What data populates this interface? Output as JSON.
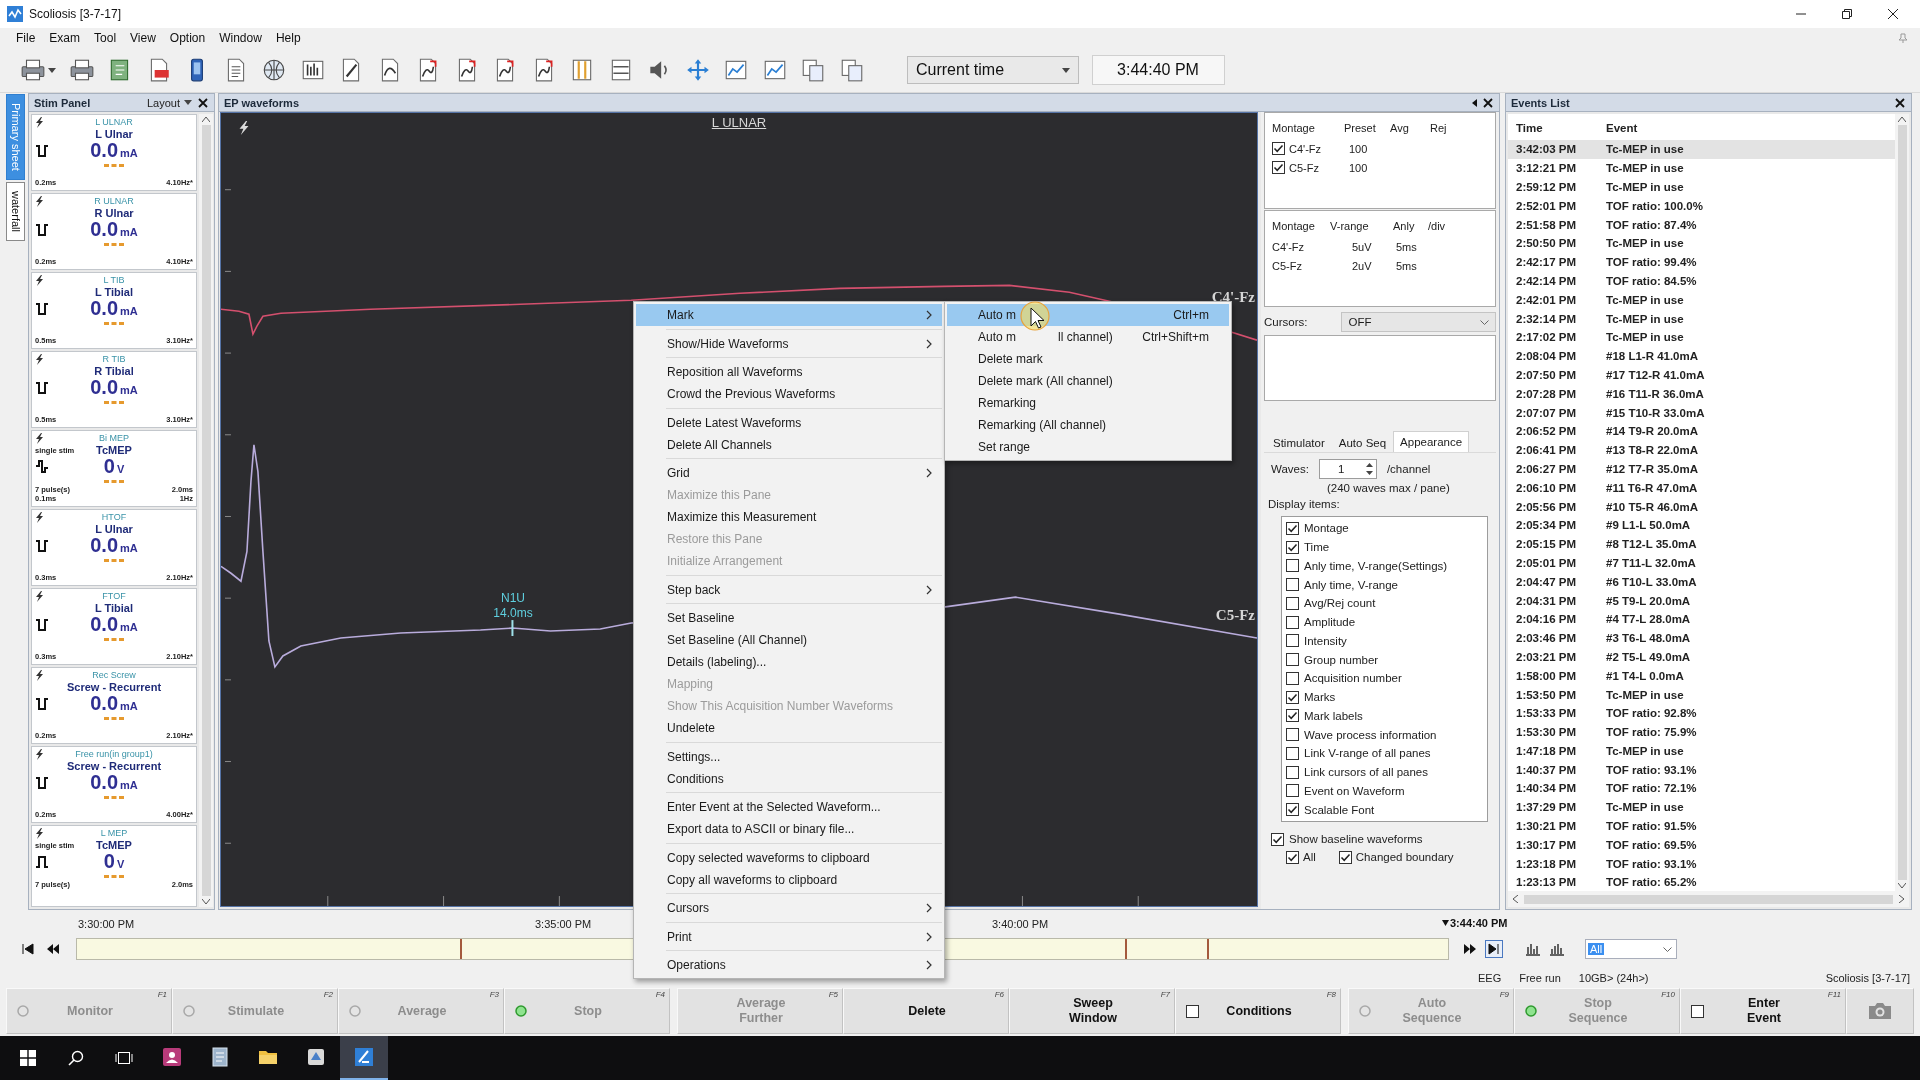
{
  "window": {
    "title": "Scoliosis [3-7-17]"
  },
  "menu_bar": [
    "File",
    "Exam",
    "Tool",
    "View",
    "Option",
    "Window",
    "Help"
  ],
  "toolbar": {
    "time_mode": "Current time",
    "time": "3:44:40 PM"
  },
  "stim_panel": {
    "title": "Stim Panel",
    "layout": "Layout",
    "sheet_tabs": [
      {
        "label": "Primary sheet",
        "selected": true
      },
      {
        "label": "waterfall",
        "selected": false
      }
    ],
    "cards": [
      {
        "kind": "biphasic",
        "title": "L ULNAR",
        "name": "L Ulnar",
        "value": "0.0",
        "unit": "mA",
        "width": "0.2ms",
        "rate": "4.10Hz*"
      },
      {
        "kind": "biphasic",
        "title": "R ULNAR",
        "name": "R Ulnar",
        "value": "0.0",
        "unit": "mA",
        "width": "0.2ms",
        "rate": "4.10Hz*"
      },
      {
        "kind": "biphasic",
        "title": "L TIB",
        "name": "L Tibial",
        "value": "0.0",
        "unit": "mA",
        "width": "0.5ms",
        "rate": "3.10Hz*"
      },
      {
        "kind": "biphasic",
        "title": "R TIB",
        "name": "R Tibial",
        "value": "0.0",
        "unit": "mA",
        "width": "0.5ms",
        "rate": "3.10Hz*"
      },
      {
        "kind": "step",
        "mode": "single stim",
        "title": "Bi MEP",
        "name": "TcMEP",
        "value": "0",
        "unit": "V",
        "pulses": "7 pulse(s)",
        "width": "0.1ms",
        "interval": "2.0ms",
        "rate": "1Hz"
      },
      {
        "kind": "biphasic",
        "title": "HTOF",
        "name": "L Ulnar",
        "value": "0.0",
        "unit": "mA",
        "width": "0.3ms",
        "rate": "2.10Hz*"
      },
      {
        "kind": "biphasic",
        "title": "FTOF",
        "name": "L Tibial",
        "value": "0.0",
        "unit": "mA",
        "width": "0.3ms",
        "rate": "2.10Hz*"
      },
      {
        "kind": "biphasic",
        "title": "Rec Screw",
        "name": "Screw - Recurrent",
        "value": "0.0",
        "unit": "mA",
        "width": "0.2ms",
        "rate": "2.10Hz*"
      },
      {
        "kind": "biphasic",
        "title": "Free run(in group1)",
        "name": "Screw - Recurrent",
        "value": "0.0",
        "unit": "mA",
        "width": "0.2ms",
        "rate": "4.00Hz*"
      },
      {
        "kind": "mono",
        "mode": "single stim",
        "title": "L MEP",
        "name": "TcMEP",
        "value": "0",
        "unit": "V",
        "pulses": "7 pulse(s)",
        "interval": "2.0ms"
      }
    ]
  },
  "ep_pane": {
    "title": "EP waveforms",
    "plot_title": "L ULNAR",
    "traces": [
      {
        "label": "C4'-Fz",
        "color": "#d4506e"
      },
      {
        "label": "C5-Fz",
        "color": "#b9acdc"
      }
    ],
    "mark": {
      "name": "N1U",
      "latency": "14.0ms"
    }
  },
  "montage_table": {
    "columns": [
      "Montage",
      "Preset",
      "Avg",
      "Rej"
    ],
    "rows": [
      {
        "montage": "C4'-Fz",
        "checked": true,
        "preset": "100"
      },
      {
        "montage": "C5-Fz",
        "checked": true,
        "preset": "100"
      }
    ]
  },
  "range_table": {
    "columns": [
      "Montage",
      "V-range",
      "Anly",
      "/div"
    ],
    "rows": [
      {
        "montage": "C4'-Fz",
        "v_range": "5uV",
        "anly": "5ms"
      },
      {
        "montage": "C5-Fz",
        "v_range": "2uV",
        "anly": "5ms"
      }
    ]
  },
  "cursors": {
    "label": "Cursors:",
    "value": "OFF"
  },
  "settings_tabs": [
    {
      "label": "Stimulator",
      "selected": false
    },
    {
      "label": "Auto Seq",
      "selected": false
    },
    {
      "label": "Appearance",
      "selected": true
    }
  ],
  "waves": {
    "label": "Waves:",
    "value": "1",
    "unit": "/channel",
    "note": "(240 waves max / pane)"
  },
  "display_items": {
    "label": "Display items:",
    "items": [
      {
        "label": "Montage",
        "checked": true
      },
      {
        "label": "Time",
        "checked": true
      },
      {
        "label": "Anly time, V-range(Settings)",
        "checked": false
      },
      {
        "label": "Anly time, V-range",
        "checked": false
      },
      {
        "label": "Avg/Rej count",
        "checked": false
      },
      {
        "label": "Amplitude",
        "checked": false
      },
      {
        "label": "Intensity",
        "checked": false
      },
      {
        "label": "Group number",
        "checked": false
      },
      {
        "label": "Acquisition number",
        "checked": false
      },
      {
        "label": "Marks",
        "checked": true
      },
      {
        "label": "Mark labels",
        "checked": true
      },
      {
        "label": "Wave process information",
        "checked": false
      },
      {
        "label": "Link V-range of all panes",
        "checked": false
      },
      {
        "label": "Link cursors of all panes",
        "checked": false
      },
      {
        "label": "Event on Waveform",
        "checked": false
      },
      {
        "label": "Scalable Font",
        "checked": true
      }
    ]
  },
  "baseline": {
    "label": "Show baseline waveforms",
    "checked": true,
    "options": [
      {
        "label": "All",
        "checked": true
      },
      {
        "label": "Changed boundary",
        "checked": true
      }
    ]
  },
  "events_list": {
    "title": "Events List",
    "columns": [
      "Time",
      "Event"
    ],
    "rows": [
      {
        "time": "3:42:03 PM",
        "event": "Tc-MEP in use",
        "selected": true
      },
      {
        "time": "3:12:21 PM",
        "event": "Tc-MEP in use",
        "selected": false
      },
      {
        "time": "2:59:12 PM",
        "event": "Tc-MEP in use",
        "selected": false
      },
      {
        "time": "2:52:01 PM",
        "event": "TOF ratio: 100.0%",
        "selected": false
      },
      {
        "time": "2:51:58 PM",
        "event": "TOF ratio: 87.4%",
        "selected": false
      },
      {
        "time": "2:50:50 PM",
        "event": "Tc-MEP in use",
        "selected": false
      },
      {
        "time": "2:42:17 PM",
        "event": "TOF ratio: 99.4%",
        "selected": false
      },
      {
        "time": "2:42:14 PM",
        "event": "TOF ratio: 84.5%",
        "selected": false
      },
      {
        "time": "2:42:01 PM",
        "event": "Tc-MEP in use",
        "selected": false
      },
      {
        "time": "2:32:14 PM",
        "event": "Tc-MEP in use",
        "selected": false
      },
      {
        "time": "2:17:02 PM",
        "event": "Tc-MEP in use",
        "selected": false
      },
      {
        "time": "2:08:04 PM",
        "event": "#18 L1-R 41.0mA",
        "selected": false
      },
      {
        "time": "2:07:50 PM",
        "event": "#17 T12-R 41.0mA",
        "selected": false
      },
      {
        "time": "2:07:28 PM",
        "event": "#16 T11-R 36.0mA",
        "selected": false
      },
      {
        "time": "2:07:07 PM",
        "event": "#15 T10-R 33.0mA",
        "selected": false
      },
      {
        "time": "2:06:52 PM",
        "event": "#14 T9-R 20.0mA",
        "selected": false
      },
      {
        "time": "2:06:41 PM",
        "event": "#13 T8-R 22.0mA",
        "selected": false
      },
      {
        "time": "2:06:27 PM",
        "event": "#12 T7-R 35.0mA",
        "selected": false
      },
      {
        "time": "2:06:10 PM",
        "event": "#11 T6-R 47.0mA",
        "selected": false
      },
      {
        "time": "2:05:56 PM",
        "event": "#10 T5-R 46.0mA",
        "selected": false
      },
      {
        "time": "2:05:34 PM",
        "event": "#9 L1-L 50.0mA",
        "selected": false
      },
      {
        "time": "2:05:15 PM",
        "event": "#8 T12-L 35.0mA",
        "selected": false
      },
      {
        "time": "2:05:01 PM",
        "event": "#7 T11-L 32.0mA",
        "selected": false
      },
      {
        "time": "2:04:47 PM",
        "event": "#6 T10-L 33.0mA",
        "selected": false
      },
      {
        "time": "2:04:31 PM",
        "event": "#5 T9-L 20.0mA",
        "selected": false
      },
      {
        "time": "2:04:16 PM",
        "event": "#4 T7-L 28.0mA",
        "selected": false
      },
      {
        "time": "2:03:46 PM",
        "event": "#3 T6-L 48.0mA",
        "selected": false
      },
      {
        "time": "2:03:21 PM",
        "event": "#2 T5-L 49.0mA",
        "selected": false
      },
      {
        "time": "1:58:00 PM",
        "event": "#1 T4-L 0.0mA",
        "selected": false
      },
      {
        "time": "1:53:50 PM",
        "event": "Tc-MEP in use",
        "selected": false
      },
      {
        "time": "1:53:33 PM",
        "event": "TOF ratio: 92.8%",
        "selected": false
      },
      {
        "time": "1:53:30 PM",
        "event": "TOF ratio: 75.9%",
        "selected": false
      },
      {
        "time": "1:47:18 PM",
        "event": "Tc-MEP in use",
        "selected": false
      },
      {
        "time": "1:40:37 PM",
        "event": "TOF ratio: 93.1%",
        "selected": false
      },
      {
        "time": "1:40:34 PM",
        "event": "TOF ratio: 72.1%",
        "selected": false
      },
      {
        "time": "1:37:29 PM",
        "event": "Tc-MEP in use",
        "selected": false
      },
      {
        "time": "1:30:21 PM",
        "event": "TOF ratio: 91.5%",
        "selected": false
      },
      {
        "time": "1:30:17 PM",
        "event": "TOF ratio: 69.5%",
        "selected": false
      },
      {
        "time": "1:23:18 PM",
        "event": "TOF ratio: 93.1%",
        "selected": false
      },
      {
        "time": "1:23:13 PM",
        "event": "TOF ratio: 65.2%",
        "selected": false
      }
    ]
  },
  "timeline": {
    "ticks": [
      "3:30:00 PM",
      "3:35:00 PM",
      "3:40:00 PM"
    ],
    "current": "3:44:40 PM",
    "filter": "All"
  },
  "status_bar": [
    "EEG",
    "Free run",
    "10GB> (24h>)",
    "Scoliosis [3-7-17]"
  ],
  "function_keys": [
    {
      "label": "Monitor",
      "key": "F1",
      "disabled": true,
      "kind": "lamp",
      "lit": false
    },
    {
      "label": "Stimulate",
      "key": "F2",
      "disabled": true,
      "kind": "lamp",
      "lit": false
    },
    {
      "label": "Average",
      "key": "F3",
      "disabled": true,
      "kind": "lamp",
      "lit": false
    },
    {
      "label": "Stop",
      "key": "F4",
      "disabled": true,
      "kind": "lamp",
      "lit": true
    },
    {
      "label": "Average\nFurther",
      "key": "F5",
      "disabled": true,
      "kind": "plain"
    },
    {
      "label": "Delete",
      "key": "F6",
      "disabled": false,
      "kind": "plain"
    },
    {
      "label": "Sweep\nWindow",
      "key": "F7",
      "disabled": false,
      "kind": "plain"
    },
    {
      "label": "Conditions",
      "key": "F8",
      "disabled": false,
      "kind": "check",
      "checked": false
    },
    {
      "label": "Auto\nSequence",
      "key": "F9",
      "disabled": true,
      "kind": "lamp",
      "lit": false
    },
    {
      "label": "Stop\nSequence",
      "key": "F10",
      "disabled": true,
      "kind": "lamp",
      "lit": true
    },
    {
      "label": "Enter\nEvent",
      "key": "F11",
      "disabled": false,
      "kind": "check",
      "checked": false
    }
  ],
  "context_menu": {
    "groups": [
      [
        {
          "label": "Mark",
          "submenu": true,
          "disabled": false,
          "selected": true
        }
      ],
      [
        {
          "label": "Show/Hide Waveforms",
          "submenu": true,
          "disabled": false,
          "selected": false
        }
      ],
      [
        {
          "label": "Reposition all Waveforms",
          "submenu": false,
          "disabled": false,
          "selected": false
        },
        {
          "label": "Crowd the Previous Waveforms",
          "submenu": false,
          "disabled": false,
          "selected": false
        }
      ],
      [
        {
          "label": "Delete Latest Waveforms",
          "submenu": false,
          "disabled": false,
          "selected": false
        },
        {
          "label": "Delete All Channels",
          "submenu": false,
          "disabled": false,
          "selected": false
        }
      ],
      [
        {
          "label": "Grid",
          "submenu": true,
          "disabled": false,
          "selected": false
        },
        {
          "label": "Maximize this Pane",
          "submenu": false,
          "disabled": true,
          "selected": false
        },
        {
          "label": "Maximize this Measurement",
          "submenu": false,
          "disabled": false,
          "selected": false
        },
        {
          "label": "Restore this Pane",
          "submenu": false,
          "disabled": true,
          "selected": false
        },
        {
          "label": "Initialize Arrangement",
          "submenu": false,
          "disabled": true,
          "selected": false
        }
      ],
      [
        {
          "label": "Step back",
          "submenu": true,
          "disabled": false,
          "selected": false
        }
      ],
      [
        {
          "label": "Set Baseline",
          "submenu": false,
          "disabled": false,
          "selected": false
        },
        {
          "label": "Set Baseline (All Channel)",
          "submenu": false,
          "disabled": false,
          "selected": false
        },
        {
          "label": "Details (labeling)...",
          "submenu": false,
          "disabled": false,
          "selected": false
        },
        {
          "label": "Mapping",
          "submenu": false,
          "disabled": true,
          "selected": false
        },
        {
          "label": "Show This Acquisition Number Waveforms",
          "submenu": false,
          "disabled": true,
          "selected": false
        },
        {
          "label": "Undelete",
          "submenu": false,
          "disabled": false,
          "selected": false
        }
      ],
      [
        {
          "label": "Settings...",
          "submenu": false,
          "disabled": false,
          "selected": false
        },
        {
          "label": "Conditions",
          "submenu": false,
          "disabled": false,
          "selected": false
        }
      ],
      [
        {
          "label": "Enter Event at the Selected Waveform...",
          "submenu": false,
          "disabled": false,
          "selected": false
        },
        {
          "label": "Export data to ASCII or binary file...",
          "submenu": false,
          "disabled": false,
          "selected": false
        }
      ],
      [
        {
          "label": "Copy selected waveforms to clipboard",
          "submenu": false,
          "disabled": false,
          "selected": false
        },
        {
          "label": "Copy all waveforms to clipboard",
          "submenu": false,
          "disabled": false,
          "selected": false
        }
      ],
      [
        {
          "label": "Cursors",
          "submenu": true,
          "disabled": false,
          "selected": false
        }
      ],
      [
        {
          "label": "Print",
          "submenu": true,
          "disabled": false,
          "selected": false
        }
      ],
      [
        {
          "label": "Operations",
          "submenu": true,
          "disabled": false,
          "selected": false
        }
      ]
    ]
  },
  "submenu": {
    "items": [
      {
        "label": "Auto m",
        "shortcut": "Ctrl+m",
        "selected": true
      },
      {
        "label": "Auto m",
        "label_rest": "ll channel)",
        "shortcut": "Ctrl+Shift+m",
        "selected": false
      },
      {
        "label": "Delete mark",
        "selected": false
      },
      {
        "label": "Delete mark (All channel)",
        "selected": false
      },
      {
        "label": "Remarking",
        "selected": false
      },
      {
        "label": "Remarking (All channel)",
        "selected": false
      },
      {
        "label": "Set range",
        "selected": false
      }
    ]
  },
  "taskbar": {
    "apps": [
      {
        "selected": false
      },
      {
        "selected": false
      },
      {
        "selected": false
      },
      {
        "selected": false
      },
      {
        "selected": true
      }
    ]
  }
}
